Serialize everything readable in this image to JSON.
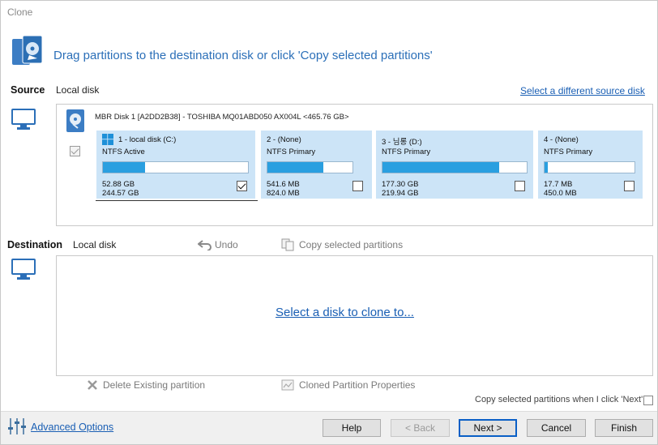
{
  "window": {
    "title": "Clone"
  },
  "header": {
    "instruction": "Drag partitions to the destination disk or click 'Copy selected partitions'"
  },
  "source": {
    "label": "Source",
    "disk_type": "Local disk",
    "change_link": "Select a different source disk",
    "disk_info": "MBR Disk 1 [A2DD2B38] - TOSHIBA MQ01ABD050 AX004L  <465.76 GB>",
    "partitions": [
      {
        "name": "1 - local disk (C:)",
        "type": "NTFS Active",
        "used": "52.88 GB",
        "total": "244.57 GB",
        "fill": 0.29,
        "checked": true
      },
      {
        "name": "2 -  (None)",
        "type": "NTFS Primary",
        "used": "541.6 MB",
        "total": "824.0 MB",
        "fill": 0.66,
        "checked": false
      },
      {
        "name": "3 - 님롱 (D:)",
        "type": "NTFS Primary",
        "used": "177.30 GB",
        "total": "219.94 GB",
        "fill": 0.81,
        "checked": false
      },
      {
        "name": "4 -  (None)",
        "type": "NTFS Primary",
        "used": "17.7 MB",
        "total": "450.0 MB",
        "fill": 0.04,
        "checked": false
      }
    ]
  },
  "destination": {
    "label": "Destination",
    "disk_type": "Local disk",
    "undo_label": "Undo",
    "copy_label": "Copy selected partitions",
    "select_link": "Select a disk to clone to...",
    "delete_label": "Delete Existing partition",
    "properties_label": "Cloned Partition Properties",
    "copy_next_label": "Copy selected partitions when I click 'Next'"
  },
  "footer": {
    "advanced_options": "Advanced Options",
    "help": "Help",
    "back": "< Back",
    "next": "Next >",
    "cancel": "Cancel",
    "finish": "Finish"
  },
  "colors": {
    "accent": "#2b6fb8",
    "partition_bg": "#cce4f7",
    "bar_fill": "#2a9fe0"
  },
  "icons": [
    "clone-disk-icon",
    "monitor-icon",
    "disk-icon",
    "windows-logo-icon",
    "undo-icon",
    "copy-icon",
    "delete-x-icon",
    "properties-icon",
    "advanced-options-sliders-icon"
  ]
}
